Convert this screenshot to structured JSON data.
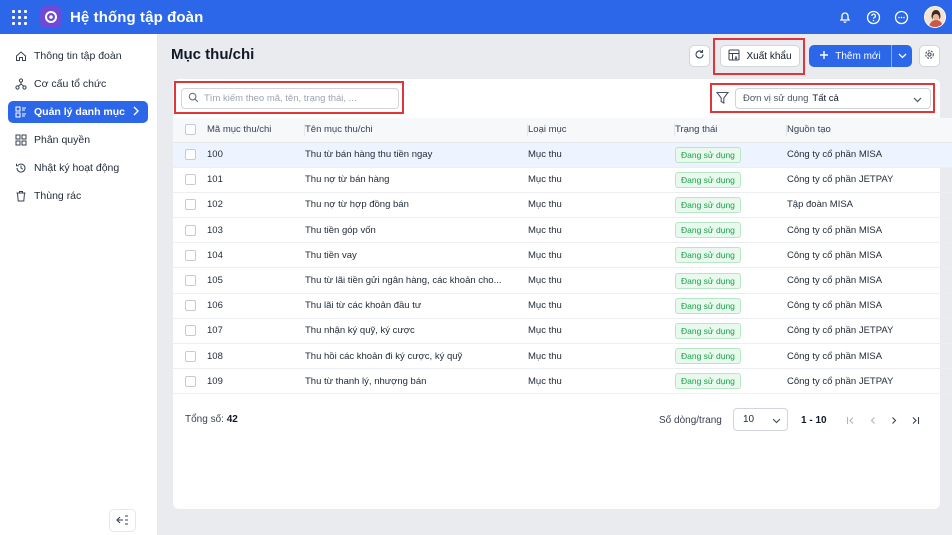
{
  "app": {
    "title": "Hệ thống tập đoàn"
  },
  "sidebar": {
    "items": [
      {
        "label": "Thông tin tập đoàn",
        "icon": "home-icon"
      },
      {
        "label": "Cơ cấu tổ chức",
        "icon": "org-chart-icon"
      },
      {
        "label": "Quản lý danh mục",
        "icon": "category-icon",
        "active": true
      },
      {
        "label": "Phân quyền",
        "icon": "permission-icon"
      },
      {
        "label": "Nhật ký hoạt động",
        "icon": "history-icon"
      },
      {
        "label": "Thùng rác",
        "icon": "trash-icon"
      }
    ]
  },
  "header": {
    "title": "Mục thu/chi",
    "export_label": "Xuất khẩu",
    "add_label": "Thêm mới"
  },
  "search": {
    "placeholder": "Tìm kiếm theo mã, tên, trạng thái, ..."
  },
  "filter": {
    "label": "Đơn vị sử dụng",
    "value": "Tất cả"
  },
  "table": {
    "columns": [
      "Mã mục thu/chi",
      "Tên mục thu/chi",
      "Loại mục",
      "Trạng thái",
      "Nguồn tạo"
    ],
    "rows": [
      {
        "code": "100",
        "name": "Thu từ bán hàng thu tiền ngay",
        "type": "Mục thu",
        "status": "Đang sử dụng",
        "source": "Công ty cổ phần MISA"
      },
      {
        "code": "101",
        "name": "Thu nợ từ bán hàng",
        "type": "Mục thu",
        "status": "Đang sử dụng",
        "source": "Công ty cổ phần JETPAY"
      },
      {
        "code": "102",
        "name": "Thu nợ từ hợp đồng bán",
        "type": "Mục thu",
        "status": "Đang sử dụng",
        "source": "Tập đoàn MISA"
      },
      {
        "code": "103",
        "name": "Thu tiền góp vốn",
        "type": "Mục thu",
        "status": "Đang sử dụng",
        "source": "Công ty cổ phần MISA"
      },
      {
        "code": "104",
        "name": "Thu tiền vay",
        "type": "Mục thu",
        "status": "Đang sử dụng",
        "source": "Công ty cổ phần MISA"
      },
      {
        "code": "105",
        "name": "Thu từ lãi tiền gửi ngân hàng, các khoản cho...",
        "type": "Mục thu",
        "status": "Đang sử dụng",
        "source": "Công ty cổ phần MISA"
      },
      {
        "code": "106",
        "name": "Thu lãi từ các khoản đầu tư",
        "type": "Mục thu",
        "status": "Đang sử dụng",
        "source": "Công ty cổ phần MISA"
      },
      {
        "code": "107",
        "name": "Thu nhận ký quỹ, ký cược",
        "type": "Mục thu",
        "status": "Đang sử dụng",
        "source": "Công ty cổ phần JETPAY"
      },
      {
        "code": "108",
        "name": "Thu hồi các khoản đi ký cược, ký quỹ",
        "type": "Mục thu",
        "status": "Đang sử dụng",
        "source": "Công ty cổ phần MISA"
      },
      {
        "code": "109",
        "name": "Thu từ thanh lý, nhượng bán",
        "type": "Mục thu",
        "status": "Đang sử dụng",
        "source": "Công ty cổ phần JETPAY"
      }
    ]
  },
  "footer": {
    "total_label": "Tổng số:",
    "total_value": "42",
    "rows_per_page_label": "Số dòng/trang",
    "rows_per_page_value": "10",
    "range": "1 - 10"
  },
  "colors": {
    "primary": "#2b67e8",
    "highlight": "#e0353a",
    "status": "#16a34a"
  }
}
